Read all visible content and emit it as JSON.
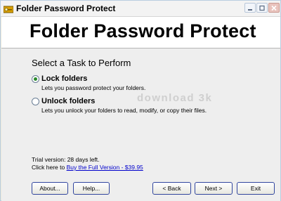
{
  "window": {
    "title": "Folder Password Protect",
    "icon": "key-icon",
    "controls": [
      "minimize-icon",
      "maximize-icon",
      "close-icon"
    ]
  },
  "banner": {
    "title": "Folder Password Protect"
  },
  "main": {
    "heading": "Select a Task to Perform",
    "options": [
      {
        "label": "Lock folders",
        "description": "Lets you password protect your folders.",
        "selected": true
      },
      {
        "label": "Unlock folders",
        "description": "Lets you unlock your folders to read, modify, or copy their files.",
        "selected": false
      }
    ],
    "watermark": "download 3k"
  },
  "trial": {
    "status": "Trial version: 28 days left.",
    "prompt": "Click here to",
    "link": "Buy the Full Version - $39.95"
  },
  "buttons": {
    "about": "About...",
    "help": "Help...",
    "back": "< Back",
    "next": "Next >",
    "exit": "Exit"
  },
  "colors": {
    "radio_selected": "#2b8a2b",
    "link": "#0000cc",
    "button_border": "#30459e"
  }
}
